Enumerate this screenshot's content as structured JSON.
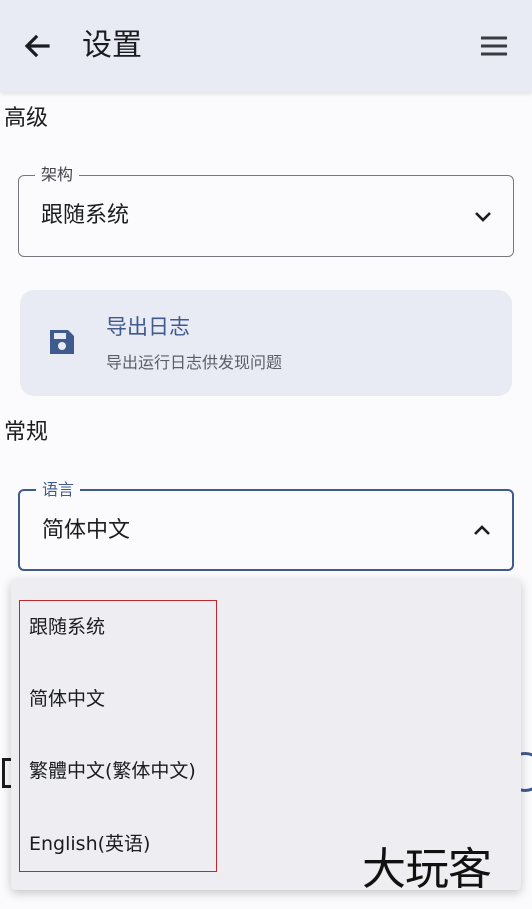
{
  "appbar": {
    "title": "设置",
    "back_icon": "arrow-back-icon",
    "menu_icon": "menu-icon"
  },
  "sections": {
    "advanced": "高级",
    "general": "常规"
  },
  "architecture": {
    "label": "架构",
    "value": "跟随系统",
    "icon": "chevron-down-icon"
  },
  "export_log": {
    "icon": "save-icon",
    "title": "导出日志",
    "subtitle": "导出运行日志供发现问题"
  },
  "language": {
    "label": "语言",
    "value": "简体中文",
    "icon": "chevron-up-icon"
  },
  "dropdown": {
    "options": [
      "跟随系统",
      "简体中文",
      "繁體中文(繁体中文)",
      "English(英语)"
    ]
  },
  "watermark": "大玩客",
  "colors": {
    "accent": "#3f5a8d",
    "highlight": "#c0282d",
    "surface": "#e8ebf4"
  }
}
